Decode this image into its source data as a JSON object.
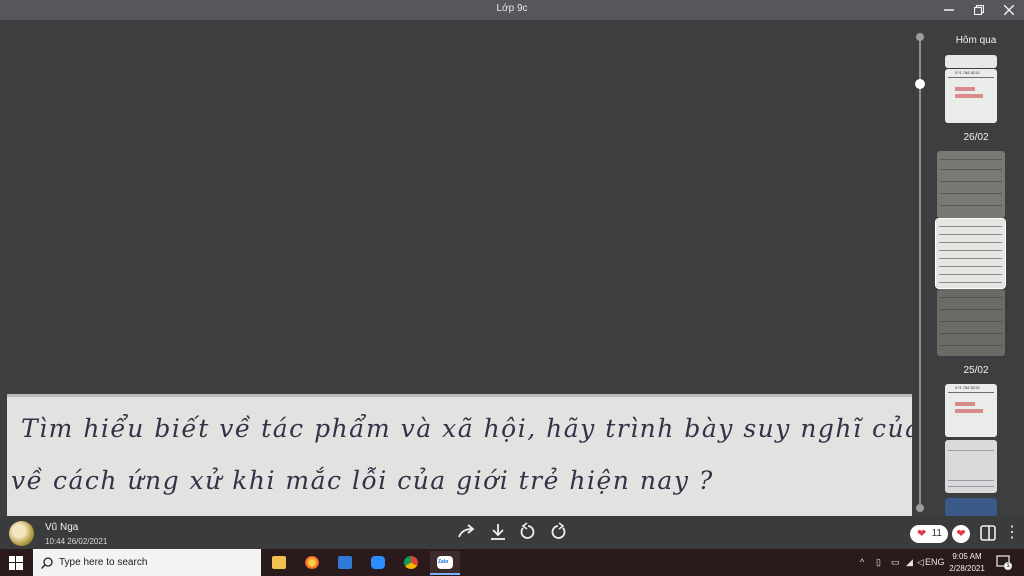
{
  "window": {
    "title": "Lớp 9c",
    "minimize_icon": "minimize-icon",
    "restore_icon": "restore-icon",
    "close_icon": "close-icon"
  },
  "photo": {
    "lines": [
      "Tìm hiểu biết về tác phẩm và xã hội, hãy trình bày suy nghĩ của em",
      "về cách ứng xử khi mắc lỗi của giới trẻ hiện nay ?"
    ]
  },
  "gallery": {
    "dates": [
      "Hôm qua",
      "26/02",
      "25/02"
    ],
    "thumb_texts": {
      "phone": "0?1 768 8213",
      "small_red": "Nh hữu"
    }
  },
  "message": {
    "sender": "Vũ Nga",
    "time": "10:44 26/02/2021",
    "reaction_count": "11"
  },
  "controls": {
    "icons": [
      "forward-icon",
      "download-icon",
      "rotate-left-icon",
      "rotate-right-icon",
      "heart-icon",
      "layout-icon",
      "more-icon"
    ]
  },
  "taskbar": {
    "search_placeholder": "Type here to search",
    "apps": [
      "file-explorer-icon",
      "firefox-icon",
      "mail-icon",
      "zoom-icon",
      "chrome-icon",
      "zalo-icon"
    ],
    "zalo_label": "Zalo",
    "language": "ENG",
    "time": "9:05 AM",
    "date": "2/28/2021",
    "notification_count": "1"
  },
  "colors": {
    "background": "#3c3e40",
    "titlebar": "#55575a",
    "heart": "#e33a4a",
    "taskbar": "#2a1a1c"
  }
}
